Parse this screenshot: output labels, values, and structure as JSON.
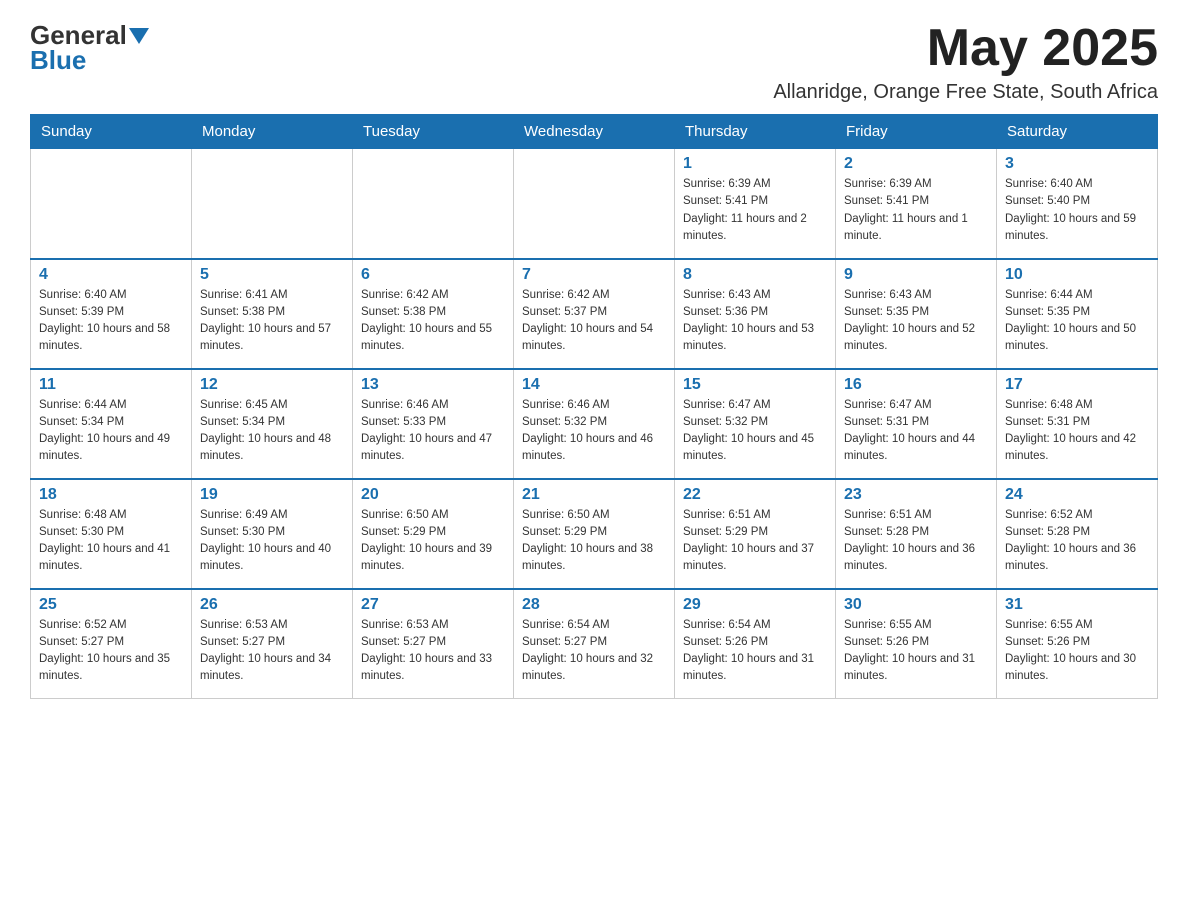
{
  "header": {
    "logo_general": "General",
    "logo_blue": "Blue",
    "month_title": "May 2025",
    "location": "Allanridge, Orange Free State, South Africa"
  },
  "days_of_week": [
    "Sunday",
    "Monday",
    "Tuesday",
    "Wednesday",
    "Thursday",
    "Friday",
    "Saturday"
  ],
  "weeks": [
    [
      {
        "day": "",
        "sunrise": "",
        "sunset": "",
        "daylight": ""
      },
      {
        "day": "",
        "sunrise": "",
        "sunset": "",
        "daylight": ""
      },
      {
        "day": "",
        "sunrise": "",
        "sunset": "",
        "daylight": ""
      },
      {
        "day": "",
        "sunrise": "",
        "sunset": "",
        "daylight": ""
      },
      {
        "day": "1",
        "sunrise": "Sunrise: 6:39 AM",
        "sunset": "Sunset: 5:41 PM",
        "daylight": "Daylight: 11 hours and 2 minutes."
      },
      {
        "day": "2",
        "sunrise": "Sunrise: 6:39 AM",
        "sunset": "Sunset: 5:41 PM",
        "daylight": "Daylight: 11 hours and 1 minute."
      },
      {
        "day": "3",
        "sunrise": "Sunrise: 6:40 AM",
        "sunset": "Sunset: 5:40 PM",
        "daylight": "Daylight: 10 hours and 59 minutes."
      }
    ],
    [
      {
        "day": "4",
        "sunrise": "Sunrise: 6:40 AM",
        "sunset": "Sunset: 5:39 PM",
        "daylight": "Daylight: 10 hours and 58 minutes."
      },
      {
        "day": "5",
        "sunrise": "Sunrise: 6:41 AM",
        "sunset": "Sunset: 5:38 PM",
        "daylight": "Daylight: 10 hours and 57 minutes."
      },
      {
        "day": "6",
        "sunrise": "Sunrise: 6:42 AM",
        "sunset": "Sunset: 5:38 PM",
        "daylight": "Daylight: 10 hours and 55 minutes."
      },
      {
        "day": "7",
        "sunrise": "Sunrise: 6:42 AM",
        "sunset": "Sunset: 5:37 PM",
        "daylight": "Daylight: 10 hours and 54 minutes."
      },
      {
        "day": "8",
        "sunrise": "Sunrise: 6:43 AM",
        "sunset": "Sunset: 5:36 PM",
        "daylight": "Daylight: 10 hours and 53 minutes."
      },
      {
        "day": "9",
        "sunrise": "Sunrise: 6:43 AM",
        "sunset": "Sunset: 5:35 PM",
        "daylight": "Daylight: 10 hours and 52 minutes."
      },
      {
        "day": "10",
        "sunrise": "Sunrise: 6:44 AM",
        "sunset": "Sunset: 5:35 PM",
        "daylight": "Daylight: 10 hours and 50 minutes."
      }
    ],
    [
      {
        "day": "11",
        "sunrise": "Sunrise: 6:44 AM",
        "sunset": "Sunset: 5:34 PM",
        "daylight": "Daylight: 10 hours and 49 minutes."
      },
      {
        "day": "12",
        "sunrise": "Sunrise: 6:45 AM",
        "sunset": "Sunset: 5:34 PM",
        "daylight": "Daylight: 10 hours and 48 minutes."
      },
      {
        "day": "13",
        "sunrise": "Sunrise: 6:46 AM",
        "sunset": "Sunset: 5:33 PM",
        "daylight": "Daylight: 10 hours and 47 minutes."
      },
      {
        "day": "14",
        "sunrise": "Sunrise: 6:46 AM",
        "sunset": "Sunset: 5:32 PM",
        "daylight": "Daylight: 10 hours and 46 minutes."
      },
      {
        "day": "15",
        "sunrise": "Sunrise: 6:47 AM",
        "sunset": "Sunset: 5:32 PM",
        "daylight": "Daylight: 10 hours and 45 minutes."
      },
      {
        "day": "16",
        "sunrise": "Sunrise: 6:47 AM",
        "sunset": "Sunset: 5:31 PM",
        "daylight": "Daylight: 10 hours and 44 minutes."
      },
      {
        "day": "17",
        "sunrise": "Sunrise: 6:48 AM",
        "sunset": "Sunset: 5:31 PM",
        "daylight": "Daylight: 10 hours and 42 minutes."
      }
    ],
    [
      {
        "day": "18",
        "sunrise": "Sunrise: 6:48 AM",
        "sunset": "Sunset: 5:30 PM",
        "daylight": "Daylight: 10 hours and 41 minutes."
      },
      {
        "day": "19",
        "sunrise": "Sunrise: 6:49 AM",
        "sunset": "Sunset: 5:30 PM",
        "daylight": "Daylight: 10 hours and 40 minutes."
      },
      {
        "day": "20",
        "sunrise": "Sunrise: 6:50 AM",
        "sunset": "Sunset: 5:29 PM",
        "daylight": "Daylight: 10 hours and 39 minutes."
      },
      {
        "day": "21",
        "sunrise": "Sunrise: 6:50 AM",
        "sunset": "Sunset: 5:29 PM",
        "daylight": "Daylight: 10 hours and 38 minutes."
      },
      {
        "day": "22",
        "sunrise": "Sunrise: 6:51 AM",
        "sunset": "Sunset: 5:29 PM",
        "daylight": "Daylight: 10 hours and 37 minutes."
      },
      {
        "day": "23",
        "sunrise": "Sunrise: 6:51 AM",
        "sunset": "Sunset: 5:28 PM",
        "daylight": "Daylight: 10 hours and 36 minutes."
      },
      {
        "day": "24",
        "sunrise": "Sunrise: 6:52 AM",
        "sunset": "Sunset: 5:28 PM",
        "daylight": "Daylight: 10 hours and 36 minutes."
      }
    ],
    [
      {
        "day": "25",
        "sunrise": "Sunrise: 6:52 AM",
        "sunset": "Sunset: 5:27 PM",
        "daylight": "Daylight: 10 hours and 35 minutes."
      },
      {
        "day": "26",
        "sunrise": "Sunrise: 6:53 AM",
        "sunset": "Sunset: 5:27 PM",
        "daylight": "Daylight: 10 hours and 34 minutes."
      },
      {
        "day": "27",
        "sunrise": "Sunrise: 6:53 AM",
        "sunset": "Sunset: 5:27 PM",
        "daylight": "Daylight: 10 hours and 33 minutes."
      },
      {
        "day": "28",
        "sunrise": "Sunrise: 6:54 AM",
        "sunset": "Sunset: 5:27 PM",
        "daylight": "Daylight: 10 hours and 32 minutes."
      },
      {
        "day": "29",
        "sunrise": "Sunrise: 6:54 AM",
        "sunset": "Sunset: 5:26 PM",
        "daylight": "Daylight: 10 hours and 31 minutes."
      },
      {
        "day": "30",
        "sunrise": "Sunrise: 6:55 AM",
        "sunset": "Sunset: 5:26 PM",
        "daylight": "Daylight: 10 hours and 31 minutes."
      },
      {
        "day": "31",
        "sunrise": "Sunrise: 6:55 AM",
        "sunset": "Sunset: 5:26 PM",
        "daylight": "Daylight: 10 hours and 30 minutes."
      }
    ]
  ]
}
